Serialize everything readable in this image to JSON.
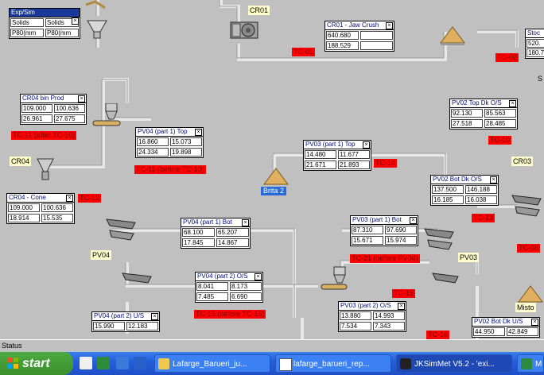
{
  "canvas": {
    "exp_sim": {
      "title": "Exp/Sim",
      "cells": [
        "Solids",
        "Solids",
        "P80(mm",
        "P80(mm"
      ]
    },
    "boxes": {
      "cr01_jaw": {
        "title": "CR01 - Jaw Crush",
        "cells": [
          "640.680",
          "",
          "188.529",
          ""
        ]
      },
      "cr04_bin": {
        "title": "CR04 bin Prod",
        "cells": [
          "109.000",
          "100.636",
          "26.961",
          "27.675"
        ]
      },
      "pv04_p1_top": {
        "title": "PV04 (part 1) Top",
        "cells": [
          "16.860",
          "15.073",
          "24.334",
          "19.898"
        ]
      },
      "pv03_p1_top": {
        "title": "PV03 (part 1) Top",
        "cells": [
          "14.480",
          "11.677",
          "21.671",
          "21.893"
        ]
      },
      "pv02_top_dk": {
        "title": "PV02 Top Dk O/S",
        "cells": [
          "92.130",
          "85.563",
          "27.518",
          "28.485"
        ]
      },
      "stock": {
        "title": "Stoc",
        "cells": [
          "520.",
          "180.7"
        ]
      },
      "cr04_cone": {
        "title": "CR04 - Cone",
        "cells": [
          "109.000",
          "100.636",
          "18.914",
          "15.535"
        ]
      },
      "pv02_bot_dk": {
        "title": "PV02 Bot Dk O/S",
        "cells": [
          "137.500",
          "146.188",
          "16.185",
          "16.038"
        ]
      },
      "pv04_p1_bot": {
        "title": "PV04 (part 1) Bot",
        "cells": [
          "68.100",
          "65.207",
          "17.845",
          "14.867"
        ]
      },
      "pv03_p1_bot": {
        "title": "PV03 (part 1) Bot",
        "cells": [
          "87.310",
          "97.690",
          "15.671",
          "15.974"
        ]
      },
      "pv04_p2_os": {
        "title": "PV04 (part 2) O/S",
        "cells": [
          "8.041",
          "8.173",
          "7.485",
          "6.690"
        ]
      },
      "pv03_p2_os": {
        "title": "PV03 (part 2) O/S",
        "cells": [
          "13.880",
          "14.993",
          "7.534",
          "7.343"
        ]
      },
      "pv04_p2_us": {
        "title": "PV04 (part 2) U/S",
        "cells": [
          "15.990",
          "12.183"
        ]
      },
      "pv02_bot_dk_us": {
        "title": "PV02 Bot Dk U/S",
        "cells": [
          "44.950",
          "42.849"
        ]
      }
    },
    "tags": {
      "tc01": "TC-01",
      "tc02": "TC-02",
      "tc11_after": "TC-11 (after TC-10)",
      "tc11_before": "TC-11 (before TC-10)",
      "tc10": "TC-10",
      "tc14": "TC-14",
      "tc12": "TC-12",
      "tc13": "TC-13",
      "tc21": "TC-21 (before PV04)",
      "tc08": "TC-08",
      "tc15_before": "TC-15 (before TC-15)",
      "tc15": "TC-15",
      "tc16": "TC-16"
    },
    "labels": {
      "cr01": "CR01",
      "cr04": "CR04",
      "cr03": "CR03",
      "pv04": "PV04",
      "pv03": "PV03",
      "brita2": "Brita 2",
      "misto": "Misto",
      "side_s": "S"
    }
  },
  "status": {
    "text": "Status"
  },
  "taskbar": {
    "start": "start",
    "tasks": [
      {
        "label": "Lafarge_Barueri_ju...",
        "icon": "folder-icon"
      },
      {
        "label": "lafarge_barueri_rep...",
        "icon": "document-icon"
      },
      {
        "label": "JKSimMet V5.2 - 'exi...",
        "icon": "app-icon"
      },
      {
        "label": "M",
        "icon": "app-icon"
      }
    ]
  }
}
